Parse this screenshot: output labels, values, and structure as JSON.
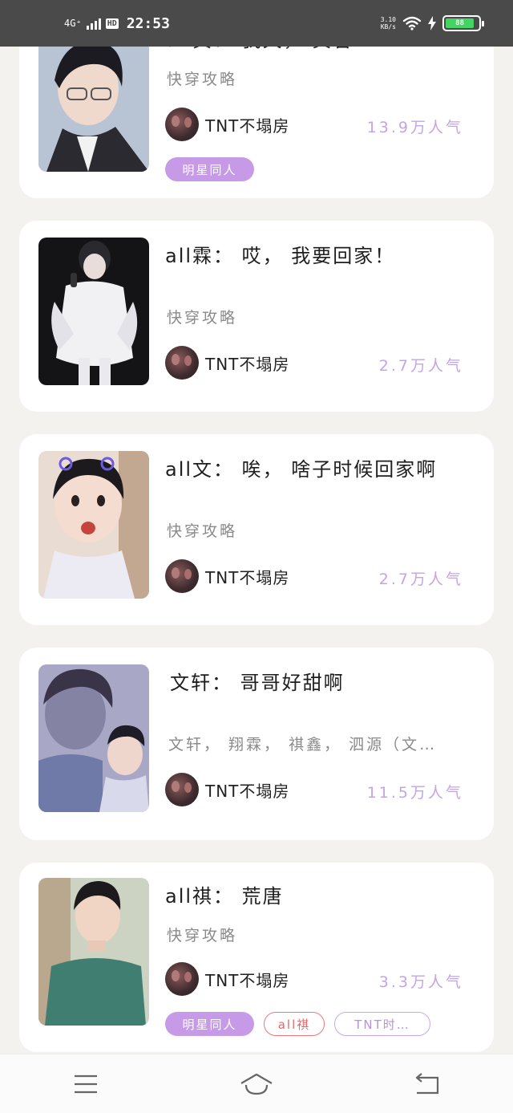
{
  "status_bar": {
    "network": "4G⁺",
    "hd": "HD",
    "time": "22:53",
    "speed_value": "3.10",
    "speed_unit": "KB/s",
    "battery": "88"
  },
  "cards": [
    {
      "title": "all真： 我天， 真香",
      "subtitle": "快穿攻略",
      "author": "TNT不塌房",
      "popularity": "13.9万人气",
      "tags": [
        "明星同人"
      ]
    },
    {
      "title": "all霖： 哎， 我要回家！",
      "subtitle": "快穿攻略",
      "author": "TNT不塌房",
      "popularity": "2.7万人气",
      "tags": []
    },
    {
      "title": "all文： 唉， 啥子时候回家啊",
      "subtitle": "快穿攻略",
      "author": "TNT不塌房",
      "popularity": "2.7万人气",
      "tags": []
    },
    {
      "title": "文轩： 哥哥好甜啊",
      "subtitle": "文轩， 翔霖， 祺鑫， 泗源（文…",
      "author": "TNT不塌房",
      "popularity": "11.5万人气",
      "tags": []
    },
    {
      "title": "all祺： 荒唐",
      "subtitle": "快穿攻略",
      "author": "TNT不塌房",
      "popularity": "3.3万人气",
      "tags": [
        "明星同人",
        "all祺",
        "TNT时…"
      ]
    }
  ],
  "colors": {
    "accent_purple": "#c79ae8",
    "popularity_purple": "#c5a4e6",
    "tag_red": "#e06a6c",
    "battery_green": "#44d462"
  },
  "nav_icons": [
    "menu-icon",
    "home-icon",
    "back-icon"
  ]
}
